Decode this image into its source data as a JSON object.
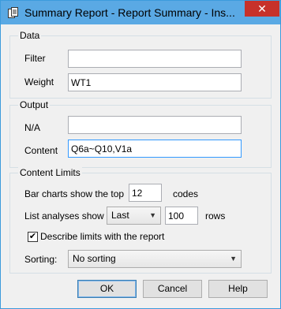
{
  "window": {
    "title": "Summary Report - Report Summary - Ins...",
    "close_glyph": "✕",
    "accent": "#5aa9e4",
    "close_color": "#c7312a"
  },
  "data_group": {
    "title": "Data",
    "filter_label": "Filter",
    "filter_value": "",
    "weight_label": "Weight",
    "weight_value": "WT1"
  },
  "output_group": {
    "title": "Output",
    "na_label": "N/A",
    "na_value": "",
    "content_label": "Content",
    "content_value": "Q6a~Q10,V1a"
  },
  "limits_group": {
    "title": "Content Limits",
    "bar_charts_label": "Bar charts show the top",
    "bar_charts_value": "12",
    "codes_label": "codes",
    "list_analyses_label": "List analyses show",
    "list_mode_selected": "Last",
    "rows_value": "100",
    "rows_label": "rows",
    "describe_checked": true,
    "describe_label": "Describe limits with the report",
    "sorting_label": "Sorting:",
    "sorting_selected": "No sorting"
  },
  "buttons": {
    "ok": "OK",
    "cancel": "Cancel",
    "help": "Help"
  }
}
